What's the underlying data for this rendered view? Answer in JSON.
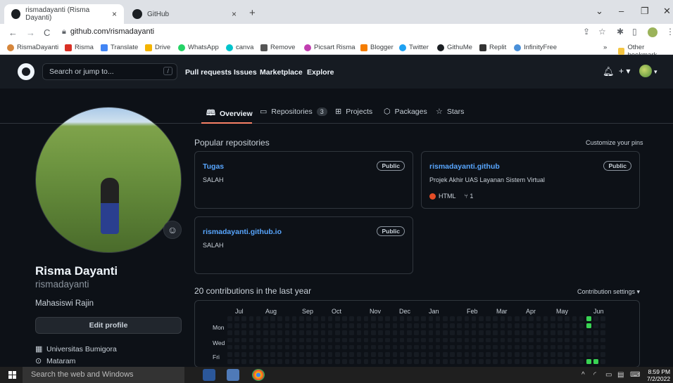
{
  "browser": {
    "tabs": [
      {
        "title": "rismadayanti (Risma Dayanti)",
        "close": "×"
      },
      {
        "title": "GitHub",
        "close": "×"
      }
    ],
    "new_tab": "+",
    "window_controls": [
      "⌄",
      "–",
      "❐",
      "✕"
    ],
    "url": "github.com/rismadayanti",
    "bookmarks": [
      {
        "label": "RismaDayanti",
        "color": "#d6863b"
      },
      {
        "label": "Risma",
        "color": "#d93025"
      },
      {
        "label": "Translate",
        "color": "#4285f4"
      },
      {
        "label": "Drive",
        "color": "#f4b400"
      },
      {
        "label": "WhatsApp",
        "color": "#25d366"
      },
      {
        "label": "canva",
        "color": "#00c4cc"
      },
      {
        "label": "Remove",
        "color": "#555555"
      },
      {
        "label": "Picsart Risma",
        "color": "#c13eb0"
      },
      {
        "label": "Blogger",
        "color": "#f57d00"
      },
      {
        "label": "Twitter",
        "color": "#1da1f2"
      },
      {
        "label": "GithuMe",
        "color": "#1b1f23"
      },
      {
        "label": "Replit",
        "color": "#333333"
      },
      {
        "label": "InfinityFree",
        "color": "#4a90d9"
      }
    ],
    "bookmarks_more": "»",
    "other_bookmarks": "Other bookmark"
  },
  "header": {
    "search_placeholder": "Search or jump to...",
    "search_shortcut": "/",
    "nav": [
      "Pull requests",
      "Issues",
      "Marketplace",
      "Explore"
    ],
    "bell": "🔔︎",
    "plus": "+ ▾",
    "avatar_caret": "▾"
  },
  "profile_tabs": [
    {
      "label": "Overview",
      "icon": "book-icon"
    },
    {
      "label": "Repositories",
      "icon": "repo-icon",
      "count": "3"
    },
    {
      "label": "Projects",
      "icon": "table-icon"
    },
    {
      "label": "Packages",
      "icon": "package-icon"
    },
    {
      "label": "Stars",
      "icon": "star-icon"
    }
  ],
  "profile": {
    "name": "Risma Dayanti",
    "login": "rismadayanti",
    "bio": "Mahasiswi Rajin",
    "edit_label": "Edit profile",
    "organization": "Universitas Bumigora",
    "location": "Mataram"
  },
  "popular": {
    "title": "Popular repositories",
    "customize": "Customize your pins",
    "repos": [
      {
        "name": "Tugas",
        "visibility": "Public",
        "description": "SALAH"
      },
      {
        "name": "rismadayanti.github",
        "visibility": "Public",
        "description": "Projek Akhir UAS Layanan Sistem Virtual",
        "language": "HTML",
        "language_color": "#e34c26",
        "forks": "1"
      },
      {
        "name": "rismadayanti.github.io",
        "visibility": "Public",
        "description": "SALAH"
      }
    ]
  },
  "contributions": {
    "title": "20 contributions in the last year",
    "settings": "Contribution settings ▾",
    "months": [
      "Jul",
      "Aug",
      "Sep",
      "Oct",
      "Nov",
      "Dec",
      "Jan",
      "Feb",
      "Mar",
      "Apr",
      "May",
      "Jun"
    ],
    "days": [
      "Mon",
      "Wed",
      "Fri"
    ],
    "active_color": "#39d353",
    "empty_color": "#161b22"
  },
  "taskbar": {
    "search": "Search the web and Windows",
    "time": "8:59 PM",
    "date": "7/2/2022"
  }
}
